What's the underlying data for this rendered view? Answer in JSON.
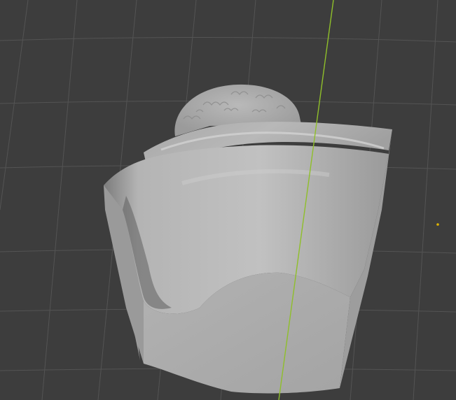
{
  "viewport": {
    "background_color": "#3d3d3d",
    "grid_color": "#545454",
    "y_axis_color": "#8fbf2a",
    "mesh_color": "#a9a9a9",
    "origin_marker_color": "#e0b400"
  },
  "scene": {
    "object": "sculpted-bust-mesh",
    "gizmos": [
      "y-axis-line",
      "object-origin-marker"
    ]
  }
}
